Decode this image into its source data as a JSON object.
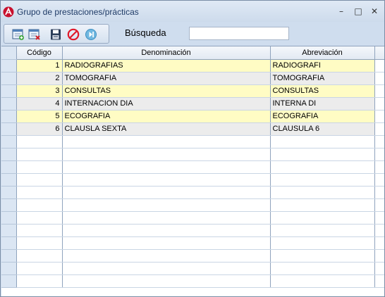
{
  "window": {
    "title": "Grupo de prestaciones/prácticas",
    "controls": {
      "minimize": "–",
      "maximize": "□",
      "close": "✕"
    }
  },
  "toolbar": {
    "buttons": [
      {
        "icon": "new-record-icon"
      },
      {
        "icon": "delete-record-icon"
      },
      {
        "icon": "save-icon"
      },
      {
        "icon": "cancel-icon"
      },
      {
        "icon": "exit-icon"
      }
    ],
    "search_label": "Búsqueda",
    "search_value": ""
  },
  "table": {
    "columns": [
      "Código",
      "Denominación",
      "Abreviación"
    ],
    "rows": [
      {
        "codigo": "1",
        "denominacion": "RADIOGRAFIAS",
        "abreviacion": "RADIOGRAFI"
      },
      {
        "codigo": "2",
        "denominacion": "TOMOGRAFIA",
        "abreviacion": "TOMOGRAFIA"
      },
      {
        "codigo": "3",
        "denominacion": "CONSULTAS",
        "abreviacion": "CONSULTAS"
      },
      {
        "codigo": "4",
        "denominacion": "INTERNACION DIA",
        "abreviacion": "INTERNA DI"
      },
      {
        "codigo": "5",
        "denominacion": "ECOGRAFIA",
        "abreviacion": "ECOGRAFIA"
      },
      {
        "codigo": "6",
        "denominacion": "CLAUSLA SEXTA",
        "abreviacion": "CLAUSULA 6"
      }
    ]
  },
  "colors": {
    "row_alt_yellow": "#fffcc4",
    "row_alt_gray": "#ececec",
    "grid_line": "#8fa3bd",
    "window_frame": "#cfddee"
  }
}
